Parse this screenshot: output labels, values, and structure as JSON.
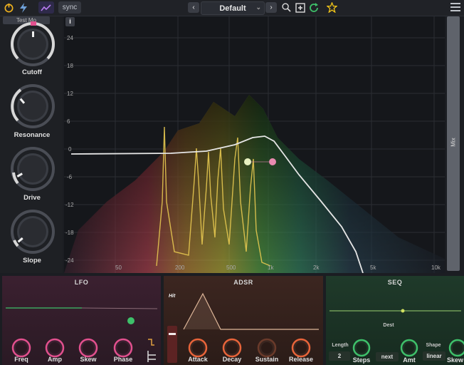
{
  "toolbar": {
    "sync_label": "sync",
    "preset_name": "Default",
    "prev_label": "‹",
    "next_label": "›",
    "dropdown_glyph": "⌄"
  },
  "left_panel": {
    "test_label": "Test Mo",
    "knobs": [
      {
        "label": "Cutoff"
      },
      {
        "label": "Resonance"
      },
      {
        "label": "Drive"
      },
      {
        "label": "Slope"
      }
    ]
  },
  "graph": {
    "info_label": "i",
    "mix_label": "Mix",
    "db_ticks": [
      "24",
      "18",
      "12",
      "6",
      "0",
      "-6",
      "-12",
      "-18",
      "-24"
    ],
    "freq_ticks": [
      "50",
      "200",
      "500",
      "1k",
      "2k",
      "5k",
      "10k"
    ]
  },
  "lfo": {
    "title": "LFO",
    "knobs": [
      "Freq",
      "Amp",
      "Skew",
      "Phase"
    ],
    "level": 0.45
  },
  "adsr": {
    "title": "ADSR",
    "hit_label": "Hit",
    "knobs": [
      "Attack",
      "Decay",
      "Sustain",
      "Release"
    ]
  },
  "seq": {
    "title": "SEQ",
    "length_label": "Length",
    "length_value": "2",
    "steps_label": "Steps",
    "dest_label": "Dest",
    "dest_value": "next",
    "amt_label": "Amt",
    "shape_label": "Shape",
    "shape_value": "linear",
    "skew_label": "Skew"
  },
  "colors": {
    "accent_pink": "#e2508e",
    "accent_green": "#3ec06a",
    "accent_orange": "#e8643a",
    "curve": "#e6e6e6"
  },
  "icons": [
    "power-icon",
    "bolt-icon",
    "graph-icon",
    "search-icon",
    "add-icon",
    "refresh-icon",
    "star-icon",
    "menu-icon"
  ]
}
